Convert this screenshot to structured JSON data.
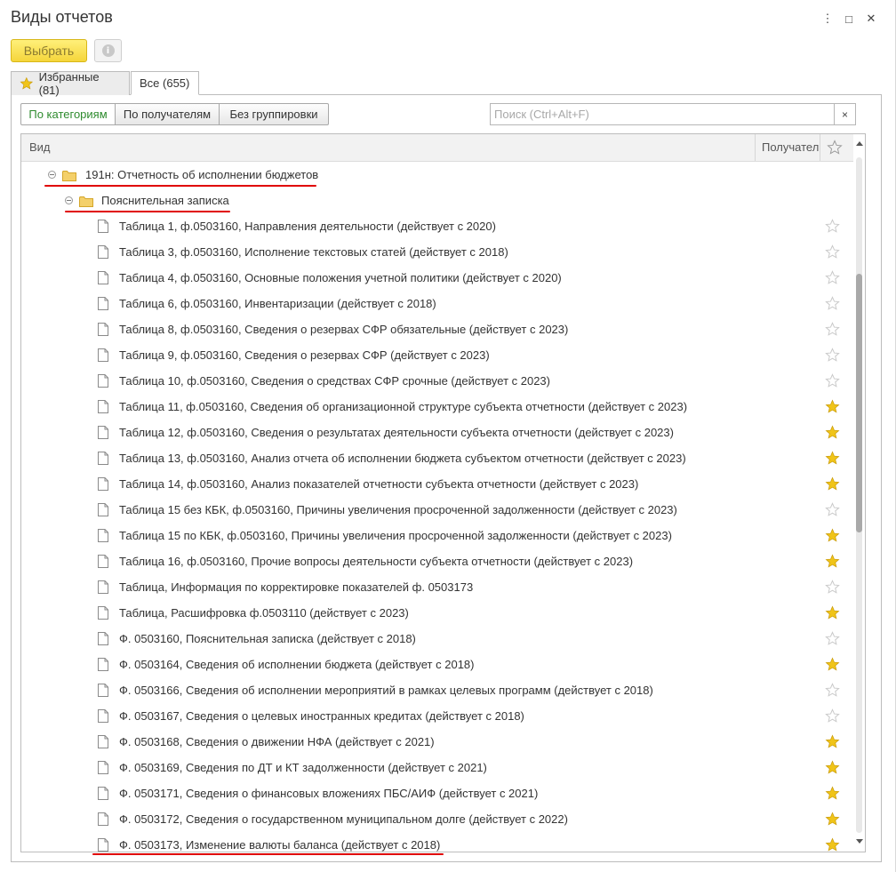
{
  "window": {
    "title": "Виды отчетов",
    "menu_glyph": "⋮",
    "maximize_glyph": "□",
    "close_glyph": "✕"
  },
  "toolbar": {
    "select_label": "Выбрать",
    "info_glyph": "i"
  },
  "tabs": [
    {
      "label": "Избранные (81)",
      "icon": "star-icon"
    },
    {
      "label": "Все (655)"
    }
  ],
  "grouping": {
    "options": [
      "По категориям",
      "По получателям",
      "Без группировки"
    ],
    "selected": "По категориям"
  },
  "search": {
    "placeholder": "Поиск (Ctrl+Alt+F)",
    "value": "",
    "clear_glyph": "×"
  },
  "table": {
    "columns": {
      "kind": "Вид",
      "recipients": "Получатели",
      "favorite": "☆"
    },
    "group": "191н: Отчетность об исполнении бюджетов",
    "subgroup": "Пояснительная записка",
    "rows": [
      {
        "label": "Таблица  1, ф.0503160, Направления деятельности (действует с 2020)",
        "favorite": false
      },
      {
        "label": "Таблица  3, ф.0503160, Исполнение текстовых статей (действует с 2018)",
        "favorite": false
      },
      {
        "label": "Таблица  4, ф.0503160, Основные положения учетной политики (действует с 2020)",
        "favorite": false
      },
      {
        "label": "Таблица  6, ф.0503160, Инвентаризации (действует с 2018)",
        "favorite": false
      },
      {
        "label": "Таблица  8, ф.0503160, Сведения о резервах СФР обязательные (действует с 2023)",
        "favorite": false
      },
      {
        "label": "Таблица  9, ф.0503160, Сведения о резервах СФР (действует с 2023)",
        "favorite": false
      },
      {
        "label": "Таблица 10, ф.0503160, Сведения о средствах СФР срочные (действует с 2023)",
        "favorite": false
      },
      {
        "label": "Таблица 11, ф.0503160, Сведения об организационной структуре субъекта отчетности (действует с 2023)",
        "favorite": true
      },
      {
        "label": "Таблица 12, ф.0503160, Сведения о результатах деятельности субъекта отчетности (действует с 2023)",
        "favorite": true
      },
      {
        "label": "Таблица 13, ф.0503160, Анализ отчета об исполнении бюджета субъектом отчетности (действует с 2023)",
        "favorite": true
      },
      {
        "label": "Таблица 14, ф.0503160, Анализ показателей отчетности субъекта отчетности (действует с 2023)",
        "favorite": true
      },
      {
        "label": "Таблица 15 без КБК, ф.0503160, Причины увеличения просроченной задолженности (действует с 2023)",
        "favorite": false
      },
      {
        "label": "Таблица 15 по КБК, ф.0503160, Причины увеличения просроченной задолженности (действует с 2023)",
        "favorite": true
      },
      {
        "label": "Таблица 16, ф.0503160, Прочие вопросы деятельности субъекта отчетности (действует с 2023)",
        "favorite": true
      },
      {
        "label": "Таблица, Информация по корректировке показателей ф. 0503173",
        "favorite": false
      },
      {
        "label": "Таблица, Расшифровка ф.0503110 (действует с 2023)",
        "favorite": true
      },
      {
        "label": "Ф. 0503160, Пояснительная записка (действует с 2018)",
        "favorite": false
      },
      {
        "label": "Ф. 0503164, Сведения об исполнении бюджета (действует с 2018)",
        "favorite": true
      },
      {
        "label": "Ф. 0503166, Сведения об исполнении мероприятий в рамках целевых программ (действует с 2018)",
        "favorite": false
      },
      {
        "label": "Ф. 0503167, Сведения о целевых иностранных кредитах (действует с 2018)",
        "favorite": false
      },
      {
        "label": "Ф. 0503168, Сведения о движении НФА (действует с 2021)",
        "favorite": true
      },
      {
        "label": "Ф. 0503169, Сведения по ДТ и КТ задолженности (действует с 2021)",
        "favorite": true
      },
      {
        "label": "Ф. 0503171, Сведения о финансовых вложениях ПБС/АИФ (действует с 2021)",
        "favorite": true
      },
      {
        "label": "Ф. 0503172, Сведения о государственном муниципальном долге (действует с 2022)",
        "favorite": true
      },
      {
        "label": "Ф. 0503173, Изменение валюты баланса (действует с 2018)",
        "favorite": true
      }
    ]
  },
  "colors": {
    "accent_yellow": "#f5d53b",
    "star_filled": "#f0c419",
    "star_empty": "#c9c9c9",
    "highlight_line": "#e00000",
    "selected_group_text": "#2e8b2e"
  }
}
